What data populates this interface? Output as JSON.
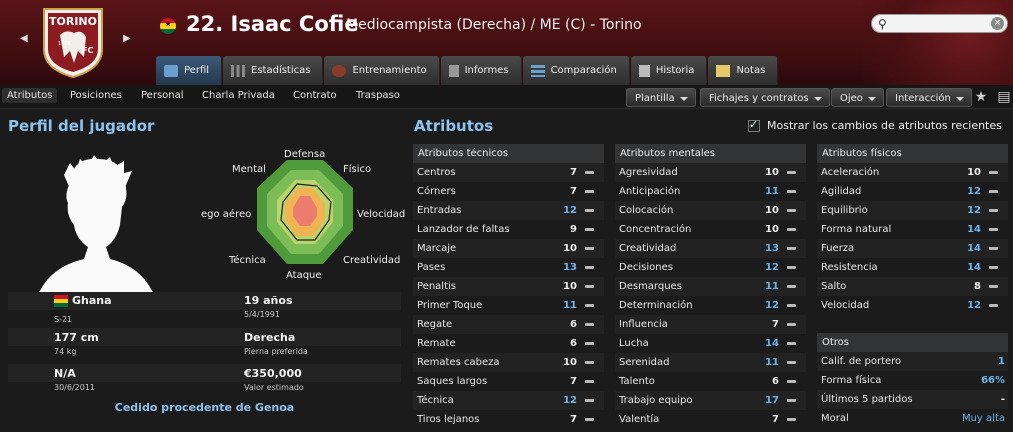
{
  "header": {
    "player_name": "22. Isaac Cofie",
    "position_club": "Mediocampista (Derecha) / ME (C) - Torino",
    "crest_text": "TORINO",
    "crest_year": "1906",
    "crest_fc": "FC"
  },
  "tabs": [
    {
      "label": "Perfil",
      "icon": "person-icon"
    },
    {
      "label": "Estadísticas",
      "icon": "stats-icon"
    },
    {
      "label": "Entrenamiento",
      "icon": "ball-icon"
    },
    {
      "label": "Informes",
      "icon": "report-icon"
    },
    {
      "label": "Comparación",
      "icon": "compare-icon"
    },
    {
      "label": "Historia",
      "icon": "history-icon"
    },
    {
      "label": "Notas",
      "icon": "notes-icon"
    }
  ],
  "subnav": {
    "items": [
      "Atributos",
      "Posiciones",
      "Personal",
      "Charla Privada",
      "Contrato",
      "Traspaso"
    ],
    "dropdowns": [
      "Plantilla",
      "Fichajes y contratos",
      "Ojeo",
      "Interacción"
    ]
  },
  "profile": {
    "title": "Perfil del jugador",
    "radar_labels": {
      "defensa": "Defensa",
      "fisico": "Físico",
      "velocidad": "Velocidad",
      "creatividad": "Creatividad",
      "ataque": "Ataque",
      "tecnica": "Técnica",
      "juego_aereo": "ego aéreo",
      "mental": "Mental"
    },
    "nationality": "Ghana",
    "nat_team": "S-21",
    "age": "19 años",
    "dob": "5/4/1991",
    "height": "177 cm",
    "weight": "74 kg",
    "foot": "Derecha",
    "foot_label": "Pierna preferida",
    "contract": "N/A",
    "contract_date": "30/6/2011",
    "value": "€350,000",
    "value_label": "Valor estimado",
    "loan": "Cedido procedente de Genoa"
  },
  "attributes": {
    "title": "Atributos",
    "show_changes": "Mostrar los cambios de atributos recientes",
    "tecnicos": {
      "heading": "Atributos técnicos",
      "rows": [
        {
          "name": "Centros",
          "value": "7"
        },
        {
          "name": "Córners",
          "value": "7"
        },
        {
          "name": "Entradas",
          "value": "12"
        },
        {
          "name": "Lanzador de faltas",
          "value": "9"
        },
        {
          "name": "Marcaje",
          "value": "10"
        },
        {
          "name": "Pases",
          "value": "13"
        },
        {
          "name": "Penaltis",
          "value": "10"
        },
        {
          "name": "Primer Toque",
          "value": "11"
        },
        {
          "name": "Regate",
          "value": "6"
        },
        {
          "name": "Remate",
          "value": "6"
        },
        {
          "name": "Remates cabeza",
          "value": "10"
        },
        {
          "name": "Saques largos",
          "value": "7"
        },
        {
          "name": "Técnica",
          "value": "12"
        },
        {
          "name": "Tiros lejanos",
          "value": "7"
        }
      ]
    },
    "mentales": {
      "heading": "Atributos mentales",
      "rows": [
        {
          "name": "Agresividad",
          "value": "10"
        },
        {
          "name": "Anticipación",
          "value": "11"
        },
        {
          "name": "Colocación",
          "value": "10"
        },
        {
          "name": "Concentración",
          "value": "10"
        },
        {
          "name": "Creatividad",
          "value": "13"
        },
        {
          "name": "Decisiones",
          "value": "12"
        },
        {
          "name": "Desmarques",
          "value": "11"
        },
        {
          "name": "Determinación",
          "value": "12"
        },
        {
          "name": "Influencia",
          "value": "7"
        },
        {
          "name": "Lucha",
          "value": "14"
        },
        {
          "name": "Serenidad",
          "value": "11"
        },
        {
          "name": "Talento",
          "value": "6"
        },
        {
          "name": "Trabajo equipo",
          "value": "17"
        },
        {
          "name": "Valentía",
          "value": "7"
        }
      ]
    },
    "fisicos": {
      "heading": "Atributos físicos",
      "rows": [
        {
          "name": "Aceleración",
          "value": "10"
        },
        {
          "name": "Agilidad",
          "value": "12"
        },
        {
          "name": "Equilibrio",
          "value": "12"
        },
        {
          "name": "Forma natural",
          "value": "14"
        },
        {
          "name": "Fuerza",
          "value": "14"
        },
        {
          "name": "Resistencia",
          "value": "14"
        },
        {
          "name": "Salto",
          "value": "8"
        },
        {
          "name": "Velocidad",
          "value": "12"
        }
      ]
    },
    "otros": {
      "heading": "Otros",
      "rows": [
        {
          "name": "Calif. de portero",
          "value": "1"
        },
        {
          "name": "Forma física",
          "value": "66%"
        },
        {
          "name": "Últimos 5 partidos",
          "value": "-"
        },
        {
          "name": "Moral",
          "value": "Muy alta"
        }
      ]
    }
  },
  "colors": {
    "accent": "#8ec3ee",
    "highlight": "#6fb3ea",
    "header": "#5a1418"
  }
}
